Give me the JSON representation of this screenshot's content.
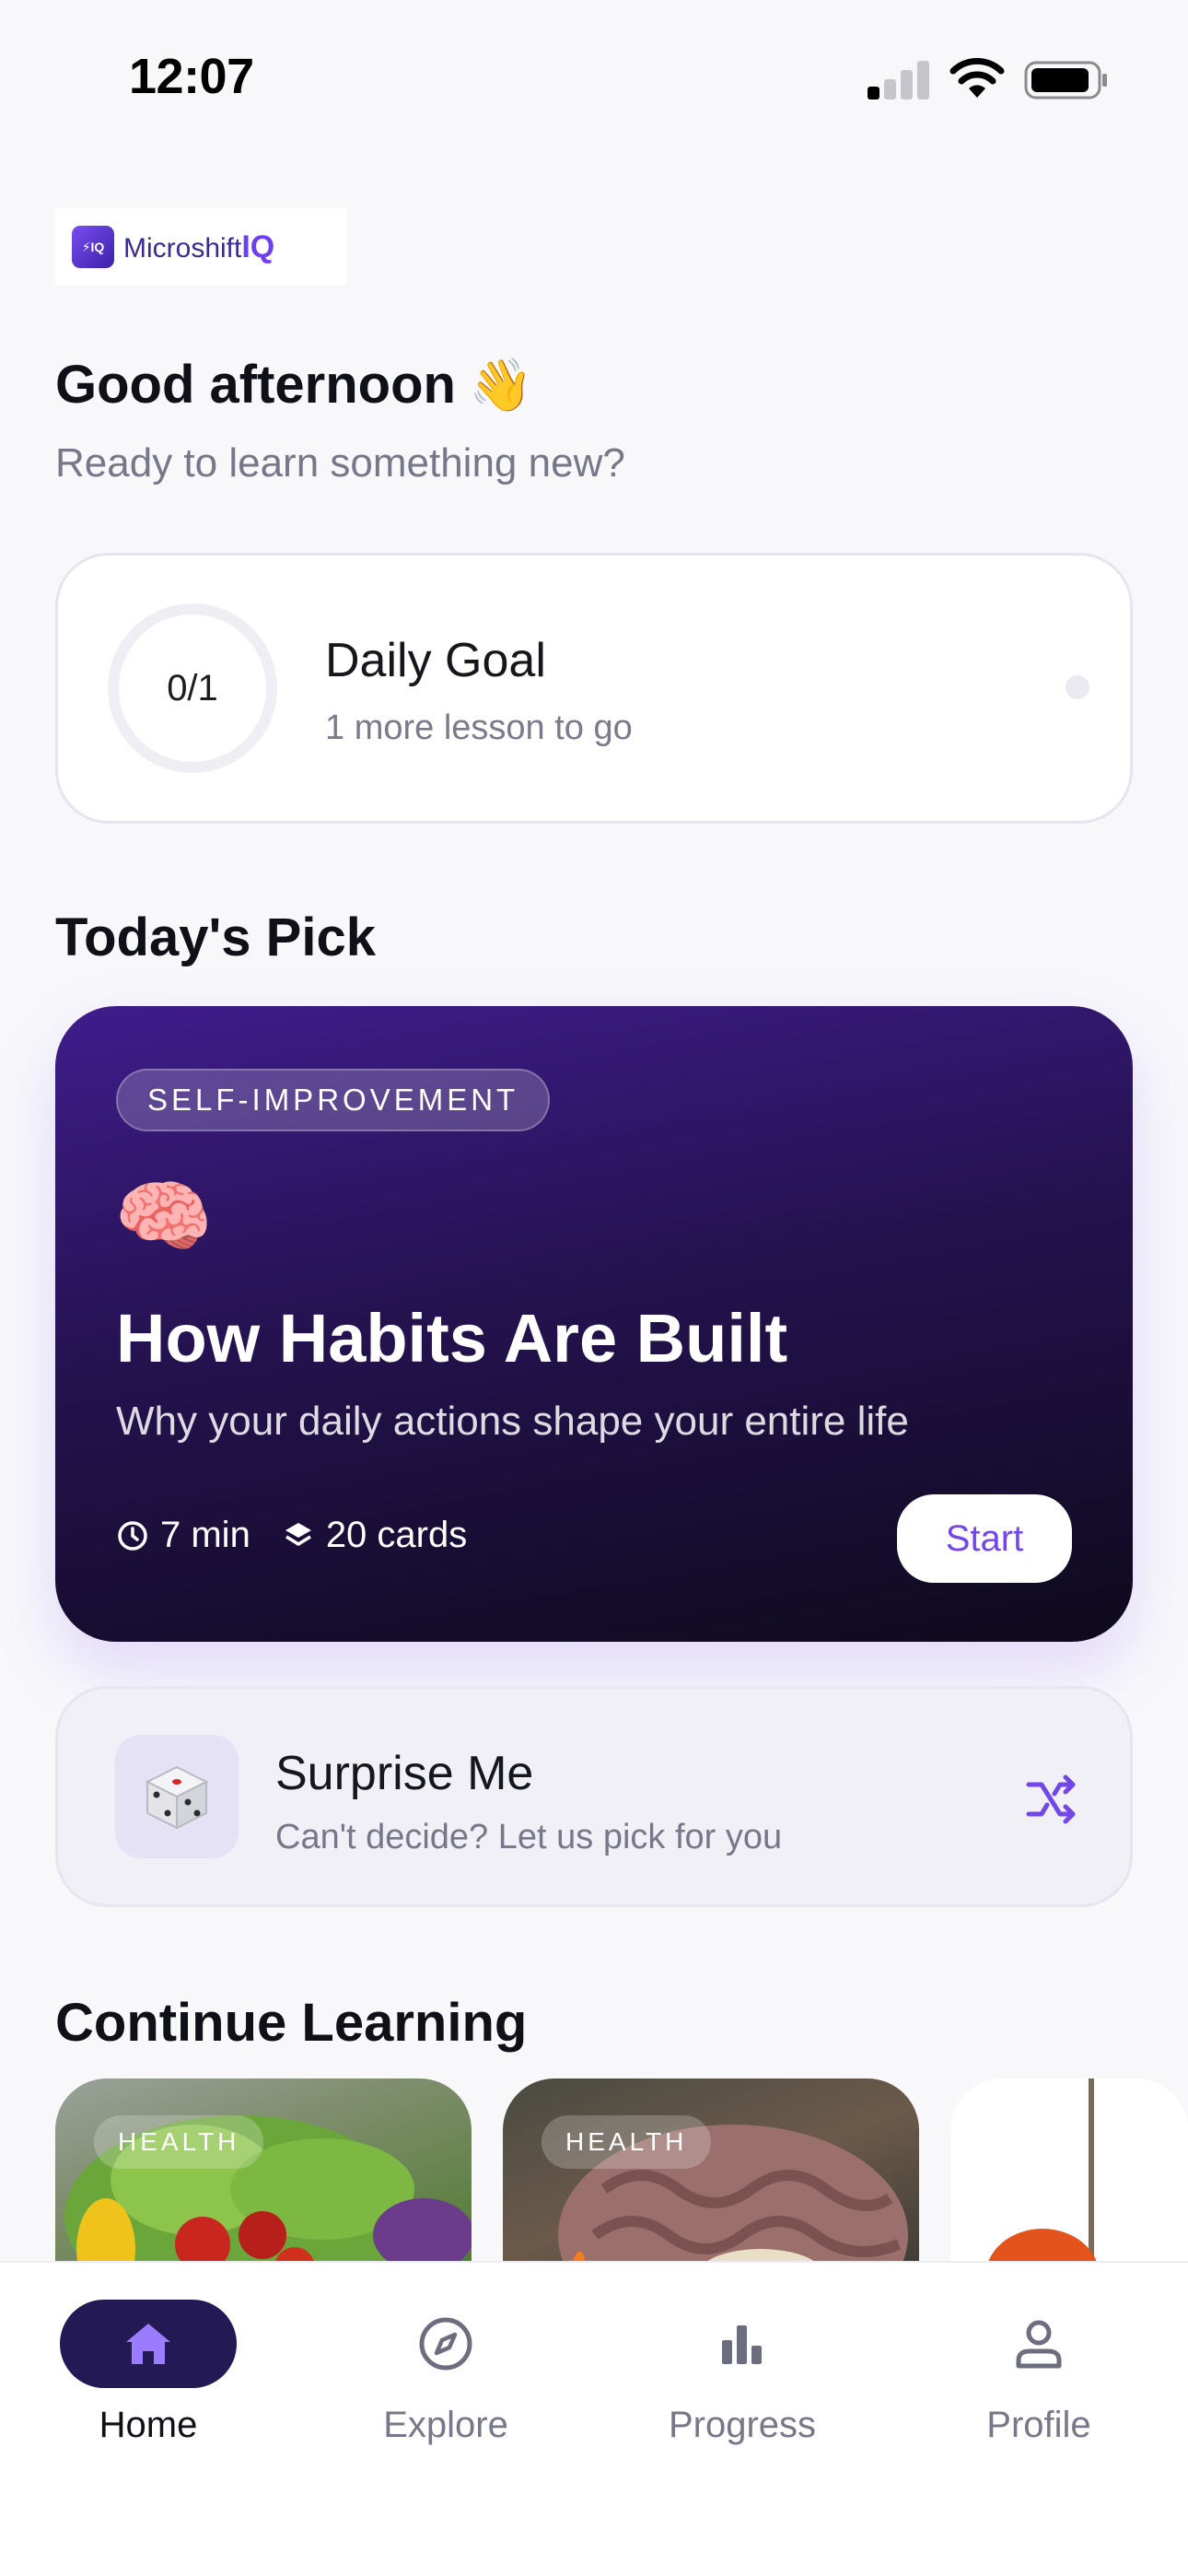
{
  "status_bar": {
    "time": "12:07"
  },
  "logo": {
    "mark": "⚡IQ",
    "text_main": "Microshift",
    "text_accent": "IQ"
  },
  "greeting": {
    "title": "Good afternoon",
    "emoji": "👋",
    "subtitle": "Ready to learn something new?"
  },
  "daily_goal": {
    "progress_text": "0/1",
    "progress": 0,
    "title": "Daily Goal",
    "subtitle": "1 more lesson to go"
  },
  "todays_pick": {
    "section_title": "Today's Pick",
    "tag": "SELF-IMPROVEMENT",
    "emoji": "🧠",
    "title": "How Habits Are Built",
    "subtitle": "Why your daily actions shape your entire life",
    "duration": "7 min",
    "cards": "20 cards",
    "start_label": "Start"
  },
  "surprise": {
    "icon": "dice-icon",
    "title": "Surprise Me",
    "subtitle": "Can't decide? Let us pick for you"
  },
  "continue_learning": {
    "section_title": "Continue Learning",
    "items": [
      {
        "tag": "HEALTH",
        "image": "salad-image"
      },
      {
        "tag": "HEALTH",
        "image": "brain-model-image"
      },
      {
        "tag": "",
        "image": "partial-card-image"
      }
    ]
  },
  "tabbar": {
    "tabs": [
      {
        "label": "Home",
        "icon": "home-icon",
        "active": true
      },
      {
        "label": "Explore",
        "icon": "compass-icon",
        "active": false
      },
      {
        "label": "Progress",
        "icon": "bar-chart-icon",
        "active": false
      },
      {
        "label": "Profile",
        "icon": "person-icon",
        "active": false
      }
    ]
  },
  "colors": {
    "accent": "#7246e8",
    "active_pill": "#231a55",
    "background": "#f8f8fb"
  }
}
